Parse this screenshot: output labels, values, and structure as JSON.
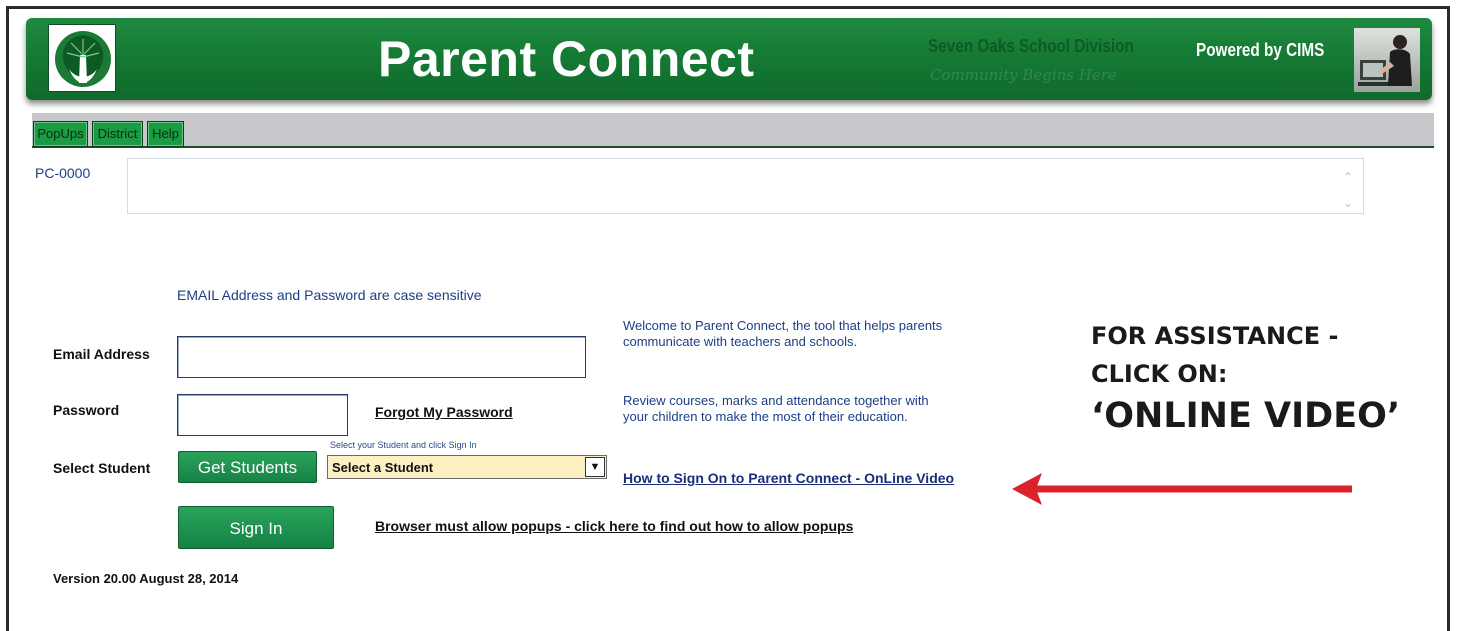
{
  "header": {
    "title": "Parent Connect",
    "division": "Seven Oaks School Division",
    "motto": "Community Begins Here",
    "powered_by": "Powered by CIMS"
  },
  "menu": {
    "tabs": [
      "PopUps",
      "District",
      "Help"
    ]
  },
  "notice": {
    "code": "PC-0000"
  },
  "login": {
    "case_note": "EMAIL Address and Password are case sensitive",
    "email_label": "Email Address",
    "email_value": "",
    "password_label": "Password",
    "password_value": "",
    "forgot_link": "Forgot My Password",
    "select_hint": "Select your Student and click Sign In",
    "student_label": "Select Student",
    "get_students_button": "Get Students",
    "student_select_value": "Select a Student",
    "sign_in_button": "Sign In",
    "popups_link": "Browser must allow popups - click here to find out how to allow popups",
    "version": "Version 20.00 August 28, 2014"
  },
  "welcome": {
    "paragraph1": "Welcome to Parent Connect, the tool that helps parents communicate with teachers and schools.",
    "paragraph2": "Review courses, marks and attendance together with your children to make the most of their education.",
    "video_link": "How to Sign On to Parent Connect - OnLine Video"
  },
  "assistance": {
    "line1": "FOR ASSISTANCE -",
    "line2": "CLICK ON:",
    "line3": "‘ONLINE VIDEO’"
  },
  "colors": {
    "banner_green": "#157a34",
    "button_green": "#1e9150",
    "link_blue": "#1a2d7a",
    "text_blue": "#1c3f86",
    "arrow_red": "#d8232a",
    "select_bg": "#fdf1c4"
  }
}
